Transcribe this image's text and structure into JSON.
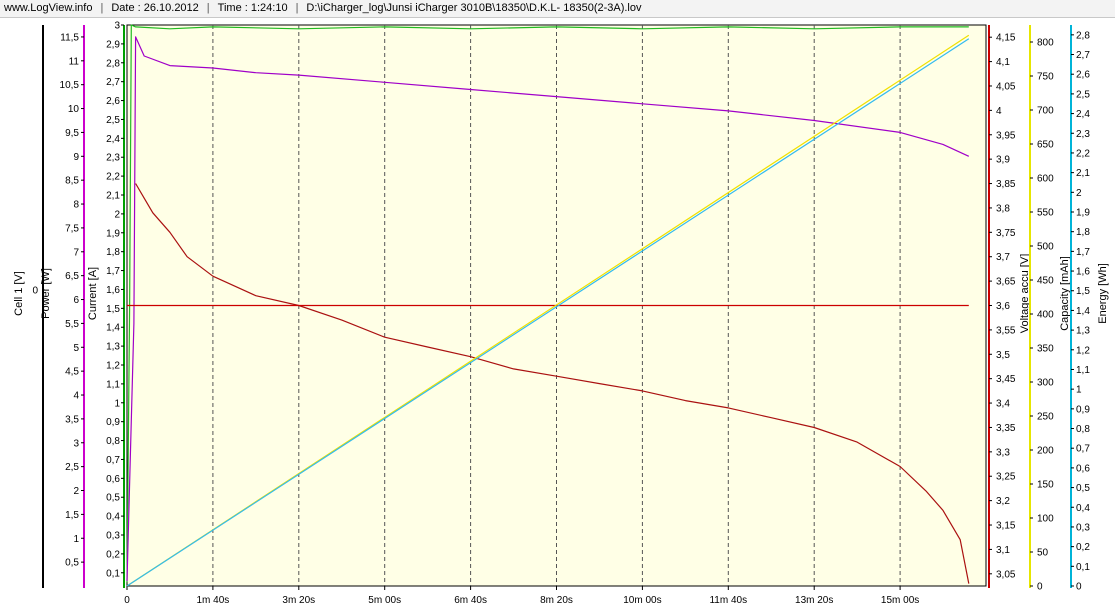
{
  "header": {
    "site": "www.LogView.info",
    "date": "Date : 26.10.2012",
    "time": "Time : 1:24:10",
    "file": "D:\\iCharger_log\\Junsi iCharger 3010B\\18350\\D.K.L- 18350(2-3A).lov"
  },
  "chart_data": {
    "type": "line",
    "x_axis": {
      "label": "",
      "unit": "s",
      "range": [
        0,
        1000
      ],
      "ticks": [
        {
          "value": 0,
          "label": "0"
        },
        {
          "value": 100,
          "label": "1m 40s"
        },
        {
          "value": 200,
          "label": "3m 20s"
        },
        {
          "value": 300,
          "label": "5m 00s"
        },
        {
          "value": 400,
          "label": "6m 40s"
        },
        {
          "value": 500,
          "label": "8m 20s"
        },
        {
          "value": 600,
          "label": "10m 00s"
        },
        {
          "value": 700,
          "label": "11m 40s"
        },
        {
          "value": 800,
          "label": "13m 20s"
        },
        {
          "value": 900,
          "label": "15m 00s"
        }
      ],
      "vertical_dashed_grid": true
    },
    "axes": {
      "cell1": {
        "label": "Cell 1 [V]",
        "color": "#000000",
        "zero_label": "0"
      },
      "power": {
        "label": "Power [W]",
        "color": "#cc00cc",
        "range": [
          0,
          11.75
        ],
        "ticks": [
          0.5,
          1,
          1.5,
          2,
          2.5,
          3,
          3.5,
          4,
          4.5,
          5,
          5.5,
          6,
          6.5,
          7,
          7.5,
          8,
          8.5,
          9,
          9.5,
          10,
          10.5,
          11,
          11.5
        ]
      },
      "current": {
        "label": "Current [A]",
        "color": "#00a000",
        "range": [
          0.03,
          3
        ],
        "ticks": [
          0.1,
          0.2,
          0.3,
          0.4,
          0.5,
          0.6,
          0.7,
          0.8,
          0.9,
          1,
          1.1,
          1.2,
          1.3,
          1.4,
          1.5,
          1.6,
          1.7,
          1.8,
          1.9,
          2,
          2.1,
          2.2,
          2.3,
          2.4,
          2.5,
          2.6,
          2.7,
          2.8,
          2.9,
          3
        ]
      },
      "voltage_accu": {
        "label": "Voltage accu [V]",
        "color": "#cc0000",
        "range": [
          3.025,
          4.175
        ],
        "ticks": [
          3.05,
          3.1,
          3.15,
          3.2,
          3.25,
          3.3,
          3.35,
          3.4,
          3.45,
          3.5,
          3.55,
          3.6,
          3.65,
          3.7,
          3.75,
          3.8,
          3.85,
          3.9,
          3.95,
          4,
          4.05,
          4.1,
          4.15
        ]
      },
      "capacity": {
        "label": "Capacity [mAh]",
        "color": "#e6e600",
        "range": [
          0,
          825
        ],
        "ticks": [
          0,
          50,
          100,
          150,
          200,
          250,
          300,
          350,
          400,
          450,
          500,
          550,
          600,
          650,
          700,
          750,
          800
        ]
      },
      "energy": {
        "label": "Energy [Wh]",
        "color": "#00b4d8",
        "range": [
          0,
          2.85
        ],
        "ticks": [
          0,
          0.1,
          0.2,
          0.3,
          0.4,
          0.5,
          0.6,
          0.7,
          0.8,
          0.9,
          1,
          1.1,
          1.2,
          1.3,
          1.4,
          1.5,
          1.6,
          1.7,
          1.8,
          1.9,
          2,
          2.1,
          2.2,
          2.3,
          2.4,
          2.5,
          2.6,
          2.7,
          2.8
        ]
      }
    },
    "series": [
      {
        "name": "Current [A]",
        "axis": "current",
        "color": "#22bb22",
        "points": [
          [
            0,
            0.05
          ],
          [
            3,
            1.5
          ],
          [
            5,
            3.0
          ],
          [
            10,
            2.99
          ],
          [
            50,
            2.98
          ],
          [
            100,
            2.99
          ],
          [
            200,
            2.98
          ],
          [
            300,
            2.99
          ],
          [
            400,
            2.98
          ],
          [
            500,
            2.99
          ],
          [
            600,
            2.98
          ],
          [
            700,
            2.99
          ],
          [
            800,
            2.98
          ],
          [
            900,
            2.99
          ],
          [
            980,
            2.99
          ]
        ]
      },
      {
        "name": "Power [W]",
        "axis": "power",
        "color": "#a000c8",
        "points": [
          [
            0,
            0.1
          ],
          [
            8,
            5.5
          ],
          [
            10,
            11.5
          ],
          [
            20,
            11.1
          ],
          [
            50,
            10.9
          ],
          [
            100,
            10.85
          ],
          [
            150,
            10.75
          ],
          [
            200,
            10.7
          ],
          [
            300,
            10.55
          ],
          [
            400,
            10.4
          ],
          [
            500,
            10.25
          ],
          [
            600,
            10.1
          ],
          [
            700,
            9.95
          ],
          [
            800,
            9.75
          ],
          [
            900,
            9.5
          ],
          [
            950,
            9.25
          ],
          [
            980,
            9.0
          ]
        ]
      },
      {
        "name": "Voltage accu [V]",
        "axis": "voltage_accu",
        "color": "#aa1111",
        "points": [
          [
            10,
            3.85
          ],
          [
            20,
            3.82
          ],
          [
            30,
            3.79
          ],
          [
            50,
            3.75
          ],
          [
            70,
            3.7
          ],
          [
            100,
            3.66
          ],
          [
            150,
            3.62
          ],
          [
            200,
            3.6
          ],
          [
            250,
            3.57
          ],
          [
            300,
            3.535
          ],
          [
            350,
            3.515
          ],
          [
            400,
            3.495
          ],
          [
            450,
            3.47
          ],
          [
            500,
            3.455
          ],
          [
            550,
            3.44
          ],
          [
            600,
            3.425
          ],
          [
            650,
            3.405
          ],
          [
            700,
            3.39
          ],
          [
            750,
            3.37
          ],
          [
            800,
            3.35
          ],
          [
            850,
            3.32
          ],
          [
            900,
            3.27
          ],
          [
            930,
            3.22
          ],
          [
            950,
            3.18
          ],
          [
            970,
            3.12
          ],
          [
            980,
            3.03
          ]
        ]
      },
      {
        "name": "Voltage accu level",
        "axis": "voltage_accu",
        "color": "#cc0000",
        "points": [
          [
            0,
            3.6
          ],
          [
            980,
            3.6
          ]
        ]
      },
      {
        "name": "Capacity [mAh]",
        "axis": "capacity",
        "color": "#f0e000",
        "points": [
          [
            0,
            0
          ],
          [
            980,
            810
          ]
        ]
      },
      {
        "name": "Energy [Wh]",
        "axis": "energy",
        "color": "#33bbee",
        "points": [
          [
            0,
            0
          ],
          [
            980,
            2.78
          ]
        ]
      }
    ]
  }
}
